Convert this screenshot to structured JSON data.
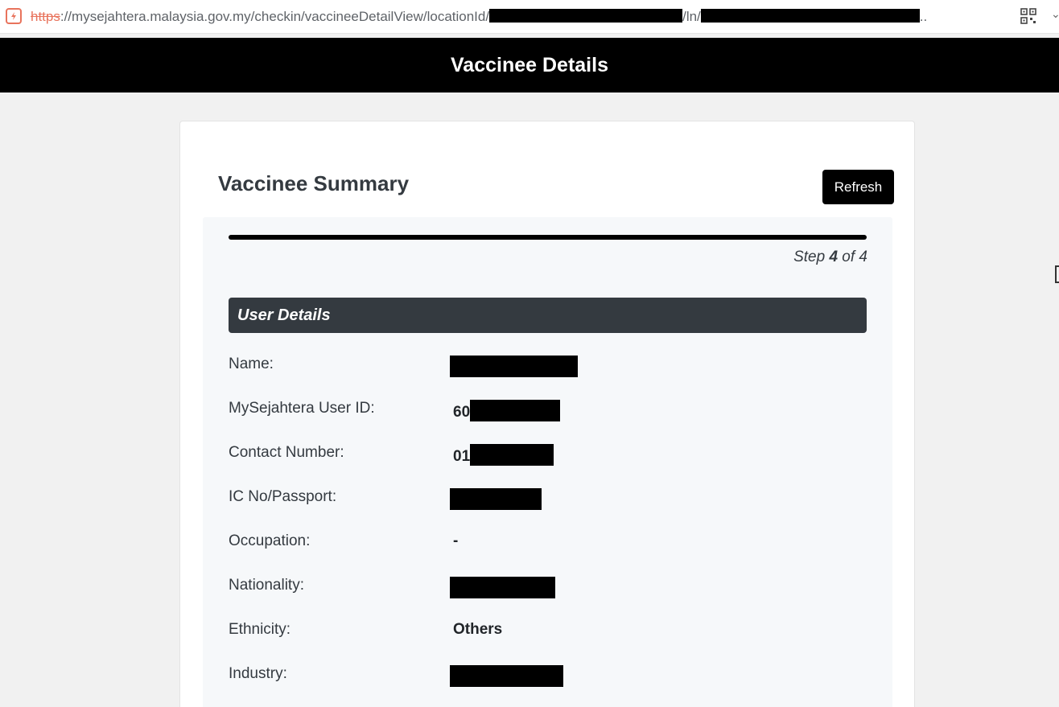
{
  "browser": {
    "url_protocol": "https",
    "url_part1": "://mysejahtera.malaysia.gov.my/checkin/vaccineeDetailView/locationId/",
    "url_part2": "/ln/",
    "url_ellipsis": ".."
  },
  "header": {
    "title": "Vaccinee Details"
  },
  "card": {
    "title": "Vaccinee Summary",
    "refresh_label": "Refresh",
    "progress_fraction": 1.0,
    "step_prefix": "Step",
    "step_current": "4",
    "step_of": "of 4",
    "section_title": "User Details",
    "rows": [
      {
        "label": "Name:",
        "value": "",
        "redact_width": 159
      },
      {
        "label": "MySejahtera User ID:",
        "value": "60",
        "redact_width": 112
      },
      {
        "label": "Contact Number:",
        "value": "01",
        "redact_width": 104
      },
      {
        "label": "IC No/Passport:",
        "value": "",
        "redact_width": 114
      },
      {
        "label": "Occupation:",
        "value": "-",
        "redact_width": 0
      },
      {
        "label": "Nationality:",
        "value": "",
        "redact_width": 131
      },
      {
        "label": "Ethnicity:",
        "value": "Others",
        "redact_width": 0
      },
      {
        "label": "Industry:",
        "value": "",
        "redact_width": 141
      }
    ]
  }
}
